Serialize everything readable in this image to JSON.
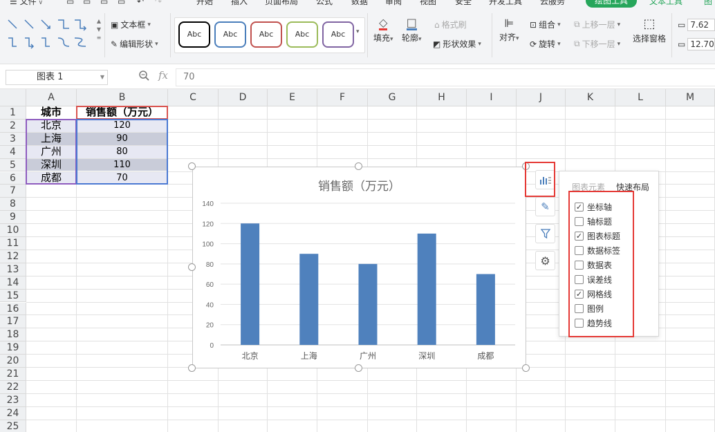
{
  "menubar": {
    "file_label": "文件",
    "tabs": [
      {
        "label": "开始"
      },
      {
        "label": "插入"
      },
      {
        "label": "页面布局"
      },
      {
        "label": "公式"
      },
      {
        "label": "数据"
      },
      {
        "label": "审阅"
      },
      {
        "label": "视图"
      },
      {
        "label": "安全"
      },
      {
        "label": "开发工具"
      },
      {
        "label": "云服务"
      }
    ],
    "active_tab": "绘图工具",
    "text_tools": "文本工具",
    "extra": "图"
  },
  "ribbon": {
    "textbox": "文本框",
    "edit_shape": "编辑形状",
    "style_sample": "Abc",
    "style_colors": [
      "#000000",
      "#4a7ebb",
      "#c0504d",
      "#9bbb59",
      "#8064a2"
    ],
    "fill": "填充",
    "outline": "轮廓",
    "format_painter": "格式刷",
    "shape_effect": "形状效果",
    "align": "对齐",
    "group": "组合",
    "rotate": "旋转",
    "bring_forward": "上移一层",
    "send_backward": "下移一层",
    "selection_pane": "选择窗格",
    "height_value": "7.62",
    "width_value": "12.70"
  },
  "formula_bar": {
    "name_box": "图表 1",
    "fx": "fx",
    "value": "70"
  },
  "sheet": {
    "columns": [
      "A",
      "B",
      "C",
      "D",
      "E",
      "F",
      "G",
      "H",
      "I",
      "J",
      "K",
      "L",
      "M"
    ],
    "rows": [
      "1",
      "2",
      "3",
      "4",
      "5",
      "6",
      "7",
      "8",
      "9",
      "10",
      "11",
      "12",
      "13",
      "14",
      "15",
      "16",
      "17",
      "18",
      "19",
      "20",
      "21",
      "22",
      "23",
      "24",
      "25"
    ],
    "header": {
      "a1": "城市",
      "b1": "销售额（万元）"
    },
    "data": [
      {
        "city": "北京",
        "sales": "120"
      },
      {
        "city": "上海",
        "sales": "90"
      },
      {
        "city": "广州",
        "sales": "80"
      },
      {
        "city": "深圳",
        "sales": "110"
      },
      {
        "city": "成都",
        "sales": "70"
      }
    ]
  },
  "chart_data": {
    "type": "bar",
    "title": "销售额（万元）",
    "categories": [
      "北京",
      "上海",
      "广州",
      "深圳",
      "成都"
    ],
    "values": [
      120,
      90,
      80,
      110,
      70
    ],
    "ylim": [
      0,
      140
    ],
    "yticks": [
      "0",
      "20",
      "40",
      "60",
      "80",
      "100",
      "120",
      "140"
    ],
    "grid": true,
    "bar_color": "#4f81bd",
    "xlabel": "",
    "ylabel": ""
  },
  "chart_panel": {
    "tabs": [
      "图表元素",
      "快速布局"
    ],
    "options": [
      {
        "label": "坐标轴",
        "checked": true
      },
      {
        "label": "轴标题",
        "checked": false
      },
      {
        "label": "图表标题",
        "checked": true
      },
      {
        "label": "数据标签",
        "checked": false
      },
      {
        "label": "数据表",
        "checked": false
      },
      {
        "label": "误差线",
        "checked": false
      },
      {
        "label": "网格线",
        "checked": true
      },
      {
        "label": "图例",
        "checked": false
      },
      {
        "label": "趋势线",
        "checked": false
      }
    ]
  },
  "colors": {
    "accent_green": "#26a65b",
    "highlight_red": "#e53935"
  }
}
